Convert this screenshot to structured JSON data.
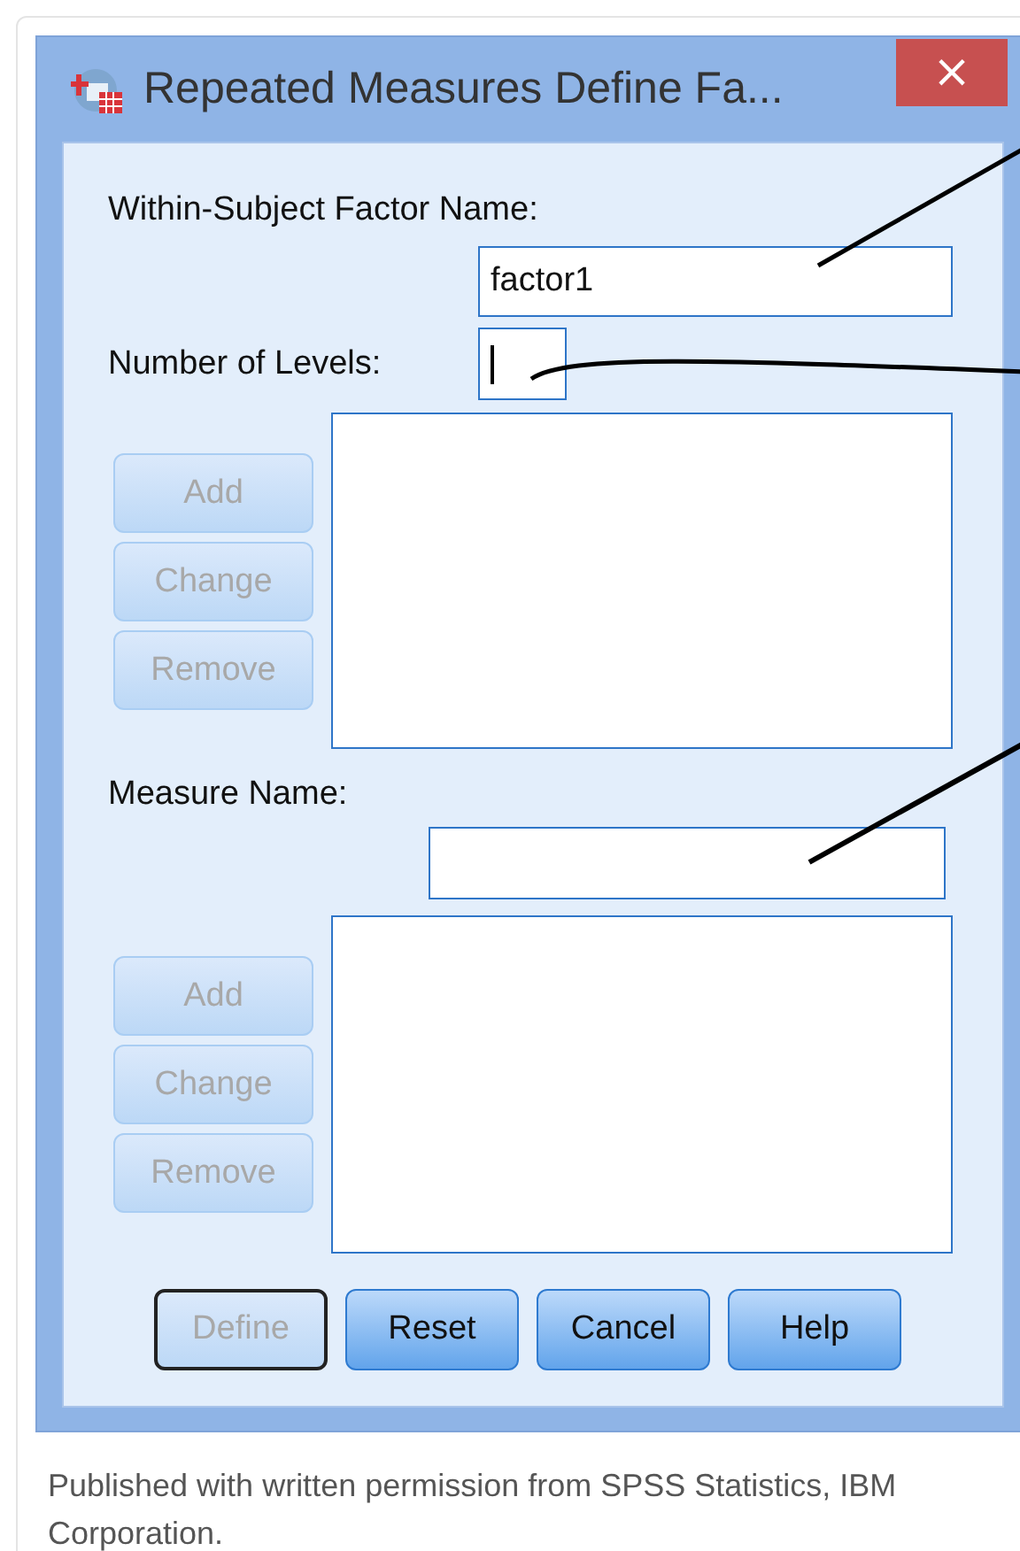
{
  "window": {
    "title": "Repeated Measures Define Fa...",
    "close_label": "×"
  },
  "factor_name": {
    "label": "Within-Subject Factor Name:",
    "value": "factor1"
  },
  "levels": {
    "label": "Number of Levels:",
    "focused": true
  },
  "factor_list": {
    "buttons": [
      {
        "label": "Add",
        "disabled": true
      },
      {
        "label": "Change",
        "disabled": true
      },
      {
        "label": "Remove",
        "disabled": true
      }
    ]
  },
  "measure_name": {
    "label": "Measure Name:",
    "focused": false
  },
  "measure_list": {
    "buttons": [
      {
        "label": "Add",
        "disabled": true
      },
      {
        "label": "Change",
        "disabled": true
      },
      {
        "label": "Remove",
        "disabled": true
      }
    ]
  },
  "footer_buttons": [
    {
      "label": "Define",
      "disabled": true,
      "default": true
    },
    {
      "label": "Reset",
      "disabled": false,
      "default": false
    },
    {
      "label": "Cancel",
      "disabled": false,
      "default": false
    },
    {
      "label": "Help",
      "disabled": false,
      "default": false
    }
  ],
  "caption": "Published with written permission from SPSS Statistics, IBM Corporation."
}
